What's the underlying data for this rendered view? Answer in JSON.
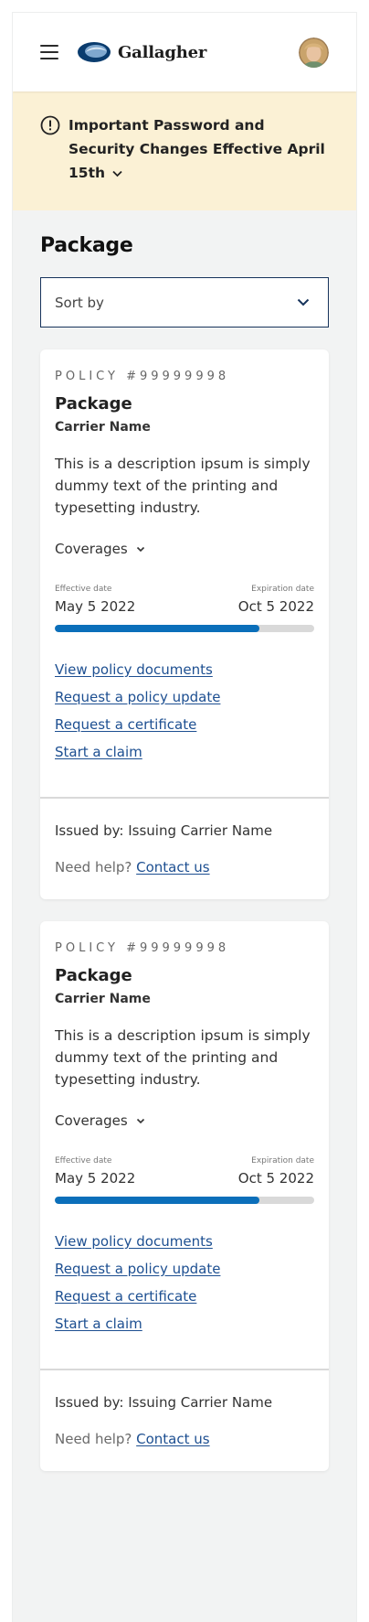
{
  "header": {
    "brand": "Gallagher",
    "menu_icon": "hamburger-menu-icon",
    "avatar_icon": "user-avatar"
  },
  "alert": {
    "text": "Important Password and Security Changes Effective April 15th",
    "icon": "exclamation-circle-icon"
  },
  "page": {
    "title": "Package",
    "sort_label": "Sort by"
  },
  "policies": [
    {
      "policy_number": "POLICY #99999998",
      "title": "Package",
      "carrier": "Carrier Name",
      "description": "This is a description ipsum is simply dummy text of the printing and typesetting industry.",
      "coverages_label": "Coverages",
      "effective_label": "Effective date",
      "effective_date": "May 5 2022",
      "expiration_label": "Expiration date",
      "expiration_date": "Oct 5 2022",
      "progress_percent": 79,
      "links": [
        "View policy documents",
        "Request a policy update",
        "Request a certificate",
        "Start a claim"
      ],
      "issued_by_label": "Issued by:",
      "issued_by": "Issuing Carrier Name",
      "help_text": "Need help?",
      "contact_label": "Contact us"
    },
    {
      "policy_number": "POLICY #99999998",
      "title": "Package",
      "carrier": "Carrier Name",
      "description": "This is a description ipsum is simply dummy text of the printing and typesetting industry.",
      "coverages_label": "Coverages",
      "effective_label": "Effective date",
      "effective_date": "May 5 2022",
      "expiration_label": "Expiration date",
      "expiration_date": "Oct 5 2022",
      "progress_percent": 79,
      "links": [
        "View policy documents",
        "Request a policy update",
        "Request a certificate",
        "Start a claim"
      ],
      "issued_by_label": "Issued by:",
      "issued_by": "Issuing Carrier Name",
      "help_text": "Need help?",
      "contact_label": "Contact us"
    }
  ],
  "colors": {
    "alert_bg": "#fbf1d5",
    "link": "#1d4f91",
    "progress": "#0b6fba",
    "sort_border": "#16335b"
  }
}
